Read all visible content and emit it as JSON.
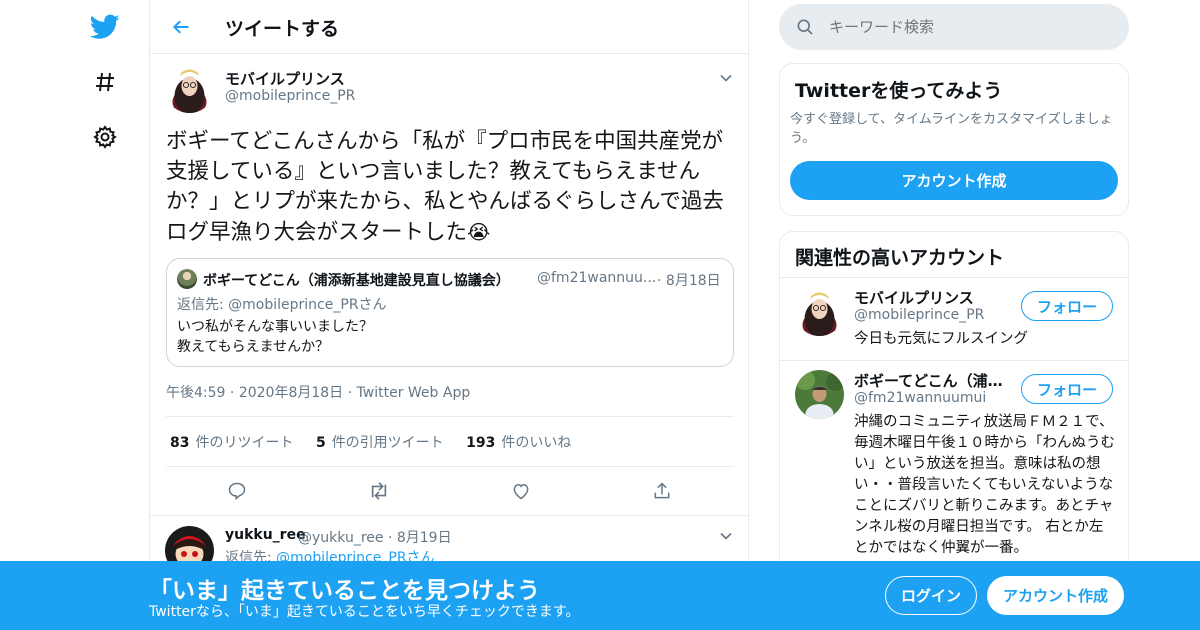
{
  "header": {
    "title": "ツイートする"
  },
  "tweet": {
    "name": "モバイルプリンス",
    "handle": "@mobileprince_PR",
    "text": "ボギーてどこんさんから「私が『プロ市民を中国共産党が支援している』といつ言いました？教えてもらえませんか？」とリプが来たから、私とやんばるぐらしさんで過去ログ早漁り大会がスタートした",
    "emoji": "😭",
    "time": "午後4:59",
    "date": "2020年8月18日",
    "source": "Twitter Web App",
    "stats": {
      "retweets_count": "83",
      "retweets_label": "件のリツイート",
      "quotes_count": "5",
      "quotes_label": "件の引用ツイート",
      "likes_count": "193",
      "likes_label": "件のいいね"
    }
  },
  "quote": {
    "name": "ボギーてどこん（浦添新基地建設見直し協議会）",
    "handle": "@fm21wannuu...",
    "date": "8月18日",
    "reply_prefix": "返信先: ",
    "reply_mention": "@mobileprince_PRさん",
    "line1": "いつ私がそんな事いいました？",
    "line2": "教えてもらえませんか？"
  },
  "reply": {
    "name": "yukku_ree",
    "handle": "@yukku_ree",
    "date": "8月19日",
    "reply_prefix": "返信先: ",
    "reply_mention": "@mobileprince_PRさん"
  },
  "search": {
    "placeholder": "キーワード検索"
  },
  "try_card": {
    "title": "Twitterを使ってみよう",
    "desc": "今すぐ登録して、タイムラインをカスタマイズしましょう。",
    "button": "アカウント作成"
  },
  "related": {
    "title": "関連性の高いアカウント",
    "accounts": [
      {
        "name": "モバイルプリンス",
        "handle": "@mobileprince_PR",
        "follow": "フォロー",
        "bio": "今日も元気にフルスイング"
      },
      {
        "name": "ボギーてどこん（浦…",
        "handle": "@fm21wannuumui",
        "follow": "フォロー",
        "bio": "沖縄のコミュニティ放送局ＦＭ２１で、毎週木曜日午後１０時から「わんぬうむい」という放送を担当。意味は私の想い・・普段言いたくてもいえないようなことにズバリと斬りこみます。あとチャンネル桜の月曜日担当です。 右とか左とかではなく仲翼が一番。"
      }
    ]
  },
  "banner": {
    "title": "「いま」起きていることを見つけよう",
    "subtitle": "Twitterなら、「いま」起きていることをいち早くチェックできます。",
    "login": "ログイン",
    "signup": "アカウント作成"
  },
  "colors": {
    "accent": "#1da1f2",
    "text": "#14171a",
    "muted": "#657786",
    "border": "#e6ecf0"
  },
  "icons": [
    "twitter-bird-icon",
    "hashtag-icon",
    "gear-icon",
    "back-arrow-icon",
    "chevron-down-icon",
    "reply-icon",
    "retweet-icon",
    "like-icon",
    "share-icon",
    "search-icon"
  ]
}
